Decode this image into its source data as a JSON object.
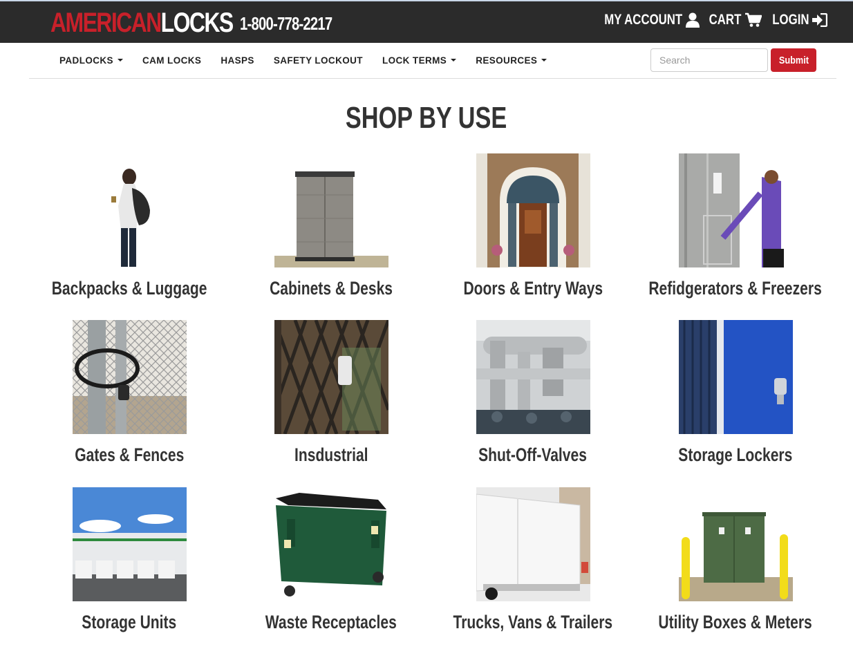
{
  "header": {
    "logo_part1": "AMERICAN",
    "logo_part2": "LOCKS",
    "phone": "1-800-778-2217",
    "links": [
      {
        "label": "MY ACCOUNT",
        "icon": "user-icon"
      },
      {
        "label": "CART",
        "icon": "cart-icon"
      },
      {
        "label": "LOGIN",
        "icon": "sign-in-icon"
      }
    ]
  },
  "nav": {
    "items": [
      {
        "label": "PADLOCKS",
        "dropdown": true
      },
      {
        "label": "CAM LOCKS",
        "dropdown": false
      },
      {
        "label": "HASPS",
        "dropdown": false
      },
      {
        "label": "SAFETY LOCKOUT",
        "dropdown": false
      },
      {
        "label": "LOCK TERMS",
        "dropdown": true
      },
      {
        "label": "RESOURCES",
        "dropdown": true
      }
    ],
    "search_placeholder": "Search",
    "submit_label": "Submit"
  },
  "main": {
    "heading": "SHOP BY USE",
    "tiles": [
      {
        "label": "Backpacks & Luggage",
        "image": "backpack-image"
      },
      {
        "label": "Cabinets & Desks",
        "image": "cabinet-image"
      },
      {
        "label": "Doors & Entry Ways",
        "image": "door-image"
      },
      {
        "label": "Refidgerators & Freezers",
        "image": "freezer-image"
      },
      {
        "label": "Gates & Fences",
        "image": "fence-image"
      },
      {
        "label": "Insdustrial",
        "image": "industrial-gate-image"
      },
      {
        "label": "Shut-Off-Valves",
        "image": "valves-image"
      },
      {
        "label": "Storage Lockers",
        "image": "storage-locker-image"
      },
      {
        "label": "Storage Units",
        "image": "warehouse-image"
      },
      {
        "label": "Waste Receptacles",
        "image": "dumpster-image"
      },
      {
        "label": "Trucks, Vans & Trailers",
        "image": "truck-image"
      },
      {
        "label": "Utility Boxes & Meters",
        "image": "utility-box-image"
      }
    ]
  },
  "colors": {
    "brand_red": "#c8202a",
    "topbar_bg": "#2b2b2b",
    "text_dark": "#333333"
  }
}
